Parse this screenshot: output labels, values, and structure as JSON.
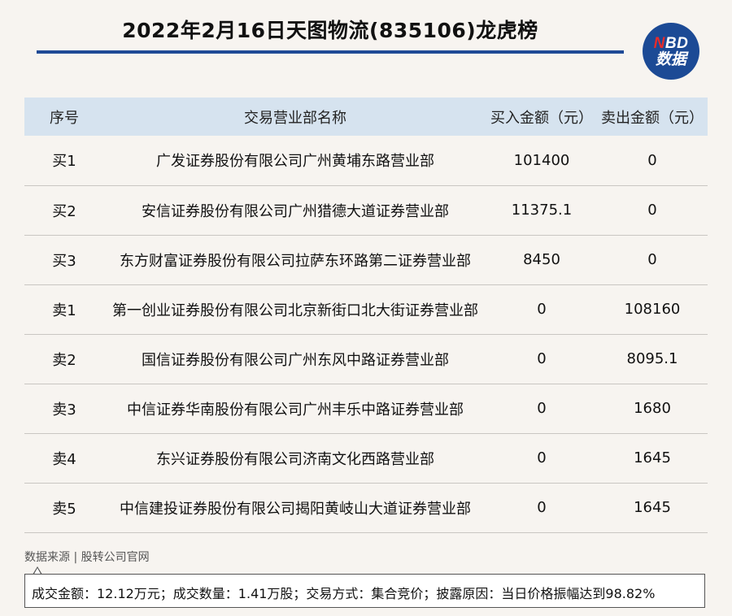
{
  "title": "2022年2月16日天图物流(835106)龙虎榜",
  "logo": {
    "line1_n": "N",
    "line1_rest": "BD",
    "line2": "数据"
  },
  "table": {
    "headers": [
      "序号",
      "交易营业部名称",
      "买入金额（元）",
      "卖出金额（元）"
    ],
    "rows": [
      [
        "买1",
        "广发证券股份有限公司广州黄埔东路营业部",
        "101400",
        "0"
      ],
      [
        "买2",
        "安信证券股份有限公司广州猎德大道证券营业部",
        "11375.1",
        "0"
      ],
      [
        "买3",
        "东方财富证券股份有限公司拉萨东环路第二证券营业部",
        "8450",
        "0"
      ],
      [
        "卖1",
        "第一创业证券股份有限公司北京新街口北大街证券营业部",
        "0",
        "108160"
      ],
      [
        "卖2",
        "国信证券股份有限公司广州东风中路证券营业部",
        "0",
        "8095.1"
      ],
      [
        "卖3",
        "中信证券华南股份有限公司广州丰乐中路证券营业部",
        "0",
        "1680"
      ],
      [
        "卖4",
        "东兴证券股份有限公司济南文化西路营业部",
        "0",
        "1645"
      ],
      [
        "卖5",
        "中信建投证券股份有限公司揭阳黄岐山大道证券营业部",
        "0",
        "1645"
      ]
    ]
  },
  "source": "数据来源 | 股转公司官网",
  "summary": "成交金额：12.12万元；成交数量：1.41万股；交易方式：集合竞价；披露原因：当日价格振幅达到98.82%",
  "colors": {
    "accent": "#1f4a96",
    "header_bg": "#d6e3ef",
    "page_bg": "#f7f4f0",
    "logo_red": "#e52b2b"
  }
}
